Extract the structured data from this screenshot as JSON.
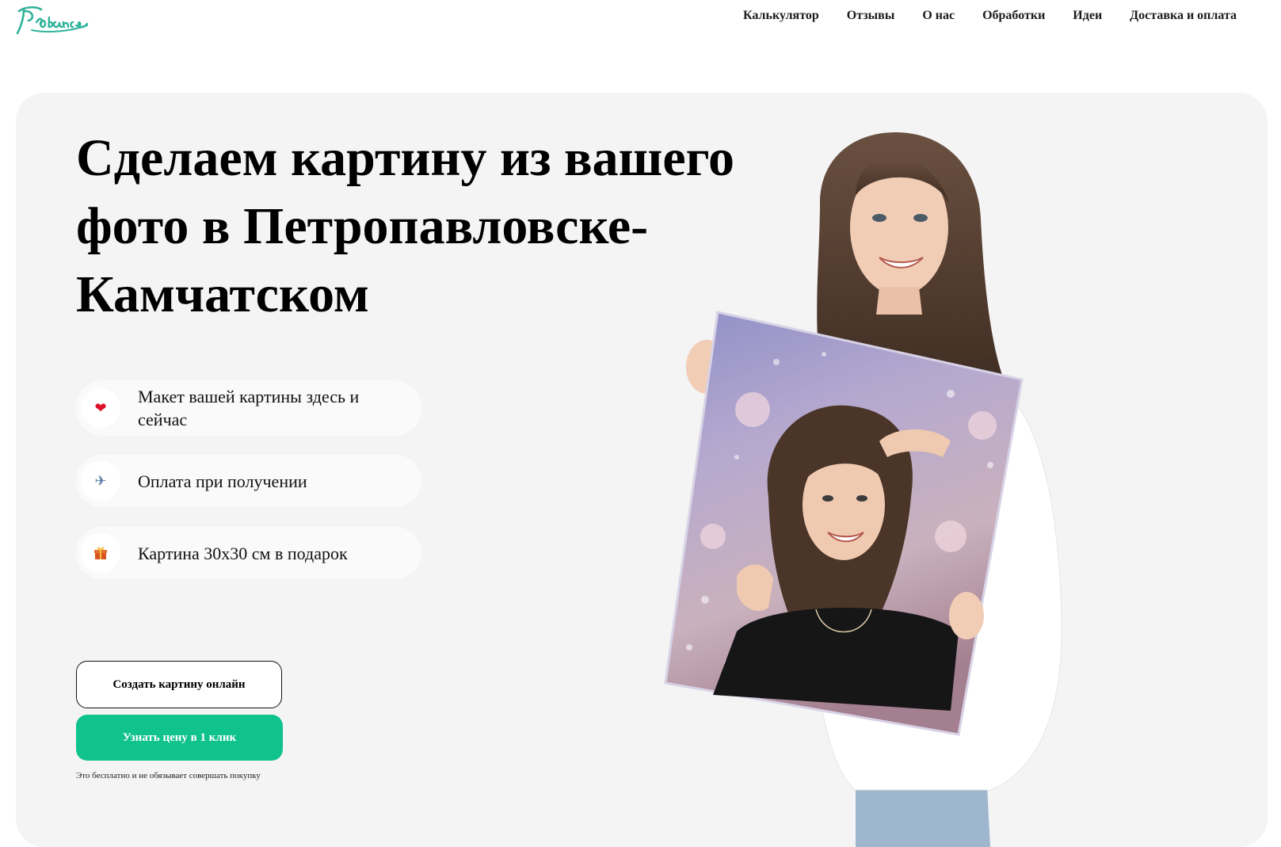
{
  "header": {
    "logo_text": "Прованс",
    "nav": [
      "Калькулятор",
      "Отзывы",
      "О нас",
      "Обработки",
      "Идеи",
      "Доставка и оплата"
    ]
  },
  "hero": {
    "title": "Сделаем картину из вашего фото в Петропавловске-Камчатском",
    "features": [
      {
        "icon": "heart-icon",
        "glyph": "❤",
        "text": "Макет вашей картины здесь и сейчас"
      },
      {
        "icon": "airplane-icon",
        "glyph": "✈",
        "text": "Оплата при получении"
      },
      {
        "icon": "gift-icon",
        "glyph": "🎁",
        "text": "Картина 30x30 см в подарок"
      }
    ],
    "btn_create": "Создать картину онлайн",
    "btn_price": "Узнать цену в 1 клик",
    "note": "Это бесплатно и не обязывает совершать покупку"
  },
  "colors": {
    "accent": "#10c38d",
    "hero_bg": "#f4f4f4",
    "logo": "#2fb39a"
  }
}
